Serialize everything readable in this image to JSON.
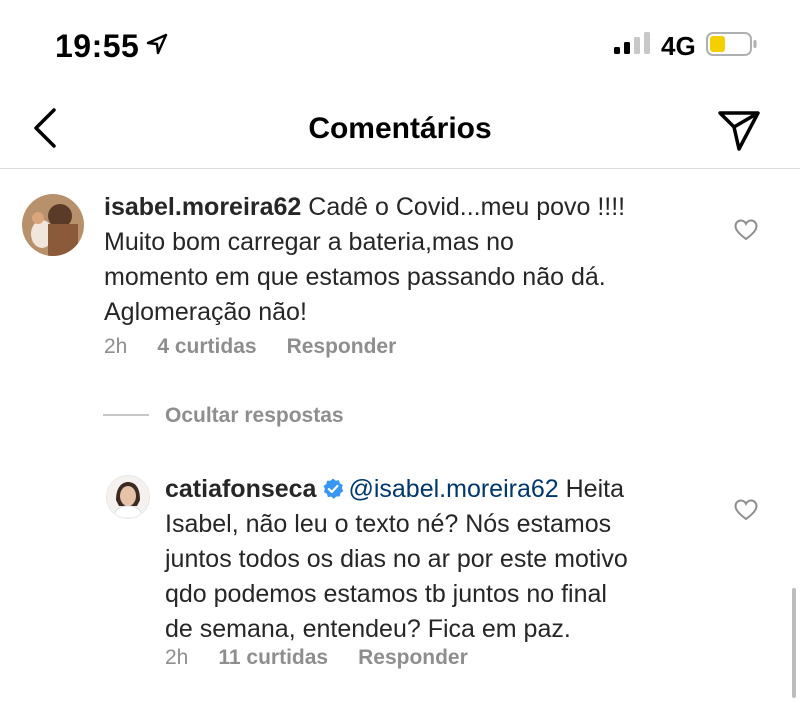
{
  "status_bar": {
    "time": "19:55",
    "network": "4G",
    "battery_color": "#f5d000"
  },
  "header": {
    "title": "Comentários"
  },
  "comments": [
    {
      "username": "isabel.moreira62",
      "text_lines": [
        "Cadê o Covid...meu povo !!!!",
        "Muito bom  carregar a bateria,mas no",
        "momento em que estamos passando  não dá.",
        "Aglomeração não!"
      ],
      "time": "2h",
      "likes": "4 curtidas",
      "reply": "Responder"
    }
  ],
  "hide_replies": "Ocultar respostas",
  "replies": [
    {
      "username": "catiafonseca",
      "mention": "@isabel.moreira62",
      "text_lines": [
        "Heita",
        "Isabel, não leu o texto né? Nós  estamos",
        "juntos todos os dias no ar por este motivo",
        "qdo podemos estamos tb juntos no final",
        "de semana, entendeu? Fica em paz."
      ],
      "time": "2h",
      "likes": "11 curtidas",
      "reply": "Responder"
    }
  ],
  "icons": {
    "back": "chevron-left-icon",
    "send": "paper-plane-icon",
    "like": "heart-outline-icon",
    "verified": "verified-badge-icon"
  },
  "colors": {
    "verified": "#3897f0",
    "mention": "#00376b",
    "muted": "#8e8e8e"
  }
}
